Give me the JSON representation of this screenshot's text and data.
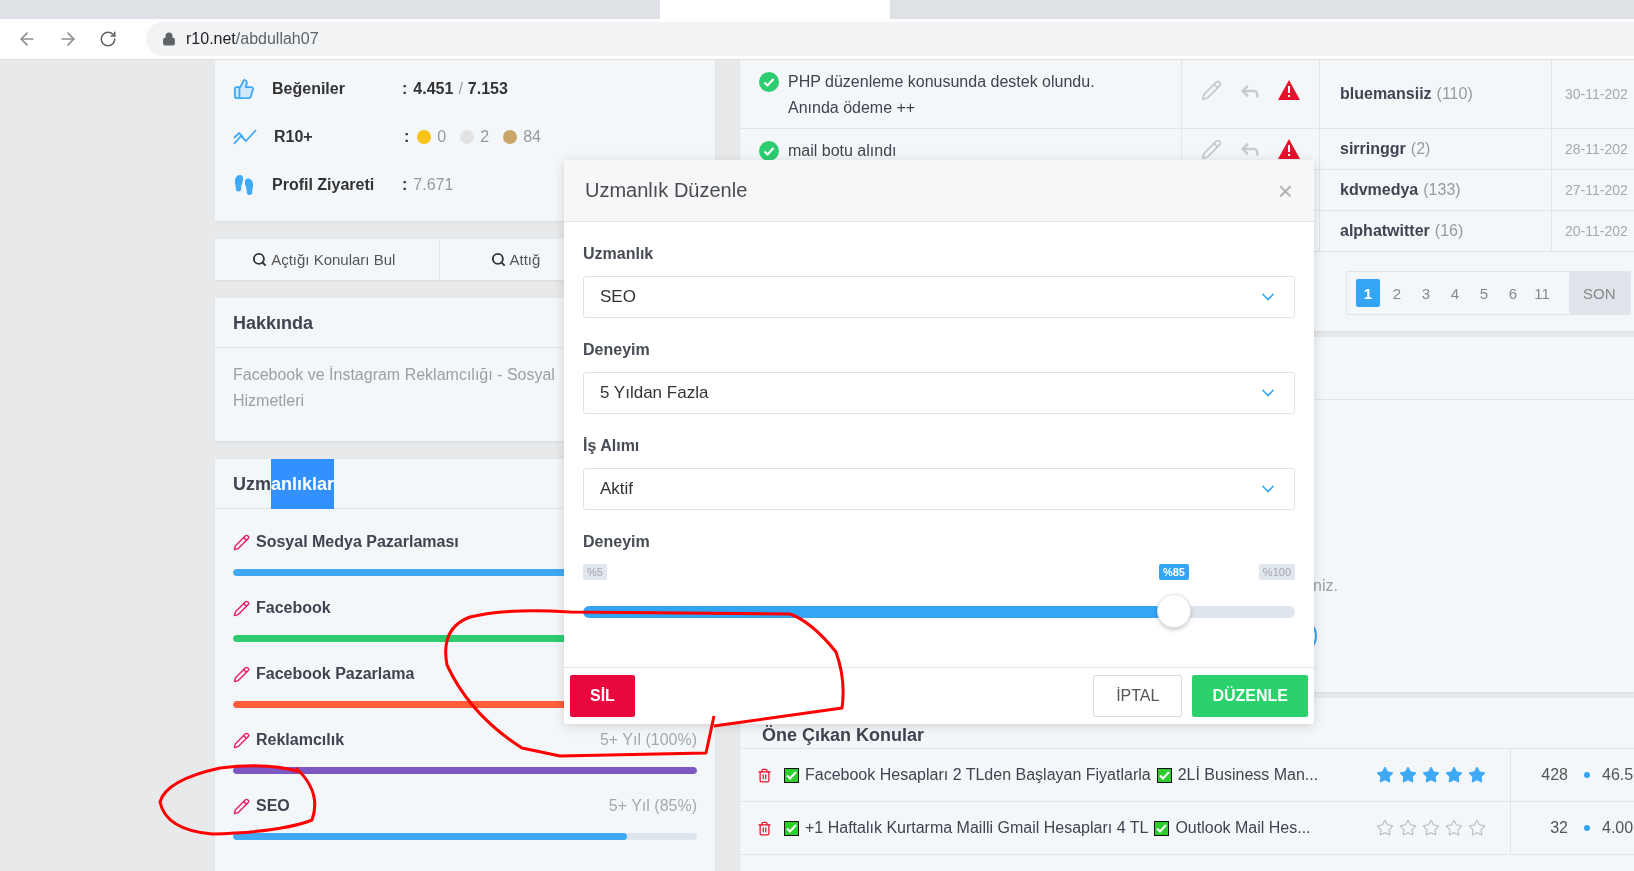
{
  "address_bar": {
    "domain": "r10.net",
    "path": "/abdullah07"
  },
  "stats": [
    {
      "kind": "likes",
      "label": "Beğeniler",
      "separator": ":",
      "value": "4.451",
      "divider": "/",
      "total": "7.153"
    },
    {
      "kind": "r10",
      "label": "R10+",
      "separator": ":",
      "medals": [
        {
          "color": "#f9c31a",
          "count": "0"
        },
        {
          "color": "#e3e3e3",
          "count": "2"
        },
        {
          "color": "#c9a66b",
          "count": "84"
        }
      ]
    },
    {
      "kind": "visits",
      "label": "Profil Ziyareti",
      "separator": ":",
      "value": "7.671"
    }
  ],
  "search_buttons": [
    "Açtığı Konuları Bul",
    "Attığ"
  ],
  "about": {
    "title": "Hakkında",
    "lines": [
      "Facebook ve İnstagram Reklamcılığı - Sosyal",
      "Hizmetleri"
    ]
  },
  "skills": {
    "title": {
      "plain": "Uzm",
      "selected": "anlıklar"
    },
    "items": [
      {
        "name": "Sosyal Medya Pazarlaması",
        "color": "#3fa9f5",
        "level": 1
      },
      {
        "name": "Facebook",
        "color": "#2ecc71",
        "level": 1
      },
      {
        "name": "Facebook Pazarlama",
        "color": "#ff5c39",
        "level": 1
      },
      {
        "name": "Reklamcılık",
        "detail": "5+ Yıl (100%)",
        "color": "#7e57c2",
        "level": 1
      },
      {
        "name": "SEO",
        "detail": "5+ Yıl (85%)",
        "color": "#3fa9f5",
        "level": 0.85
      }
    ]
  },
  "feedback": {
    "rows": [
      {
        "message_lines": [
          "PHP düzenleme konusunda destek olundu.",
          "Anında ödeme ++"
        ],
        "user": "bluemansiiz",
        "count": "(110)",
        "date": "30-11-202"
      },
      {
        "message_lines": [
          "mail botu alındı"
        ],
        "user": "sirringgr",
        "count": "(2)",
        "date": "28-11-202"
      },
      {
        "user": "kdvmedya",
        "count": "(133)",
        "date": "27-11-202"
      },
      {
        "user": "alphatwitter",
        "count": "(16)",
        "date": "20-11-202"
      }
    ],
    "pagination": [
      {
        "kind": "page",
        "label": "1",
        "selected": true
      },
      {
        "kind": "page",
        "label": "2",
        "selected": false
      },
      {
        "kind": "page",
        "label": "3",
        "selected": false
      },
      {
        "kind": "page",
        "label": "4",
        "selected": false
      },
      {
        "kind": "page",
        "label": "5",
        "selected": false
      },
      {
        "kind": "page",
        "label": "6",
        "selected": false
      },
      {
        "kind": "page",
        "label": "11",
        "selected": false
      },
      {
        "kind": "last",
        "label": "SON",
        "selected": false
      }
    ]
  },
  "notice": {
    "text": "niz."
  },
  "featured": {
    "title": "Öne Çıkan Konular",
    "rows": [
      {
        "parts": [
          "Facebook Hesapları 2 TLden Başlayan Fiyatlarla",
          "2Lİ Business Man..."
        ],
        "stars": 5,
        "count": "428",
        "score": "46.5"
      },
      {
        "parts": [
          "+1 Haftalık Kurtarma Mailli Gmail Hesapları 4 TL",
          "Outlook Mail Hes..."
        ],
        "stars": 0,
        "count": "32",
        "score": "4.00"
      }
    ]
  },
  "modal": {
    "title": "Uzmanlık Düzenle",
    "close": "×",
    "fields": [
      {
        "label": "Uzmanlık",
        "value": "SEO"
      },
      {
        "label": "Deneyim",
        "value": "5 Yıldan Fazla"
      },
      {
        "label": "İş Alımı",
        "value": "Aktif"
      }
    ],
    "slider": {
      "label": "Deneyim",
      "min_label": "%5",
      "value_label": "%85",
      "max_label": "%100",
      "level": 0.83
    },
    "buttons": [
      {
        "kind": "danger",
        "label": "SİL"
      },
      {
        "kind": "cancel",
        "label": "İPTAL"
      },
      {
        "kind": "primary",
        "label": "DÜZENLE"
      }
    ]
  }
}
